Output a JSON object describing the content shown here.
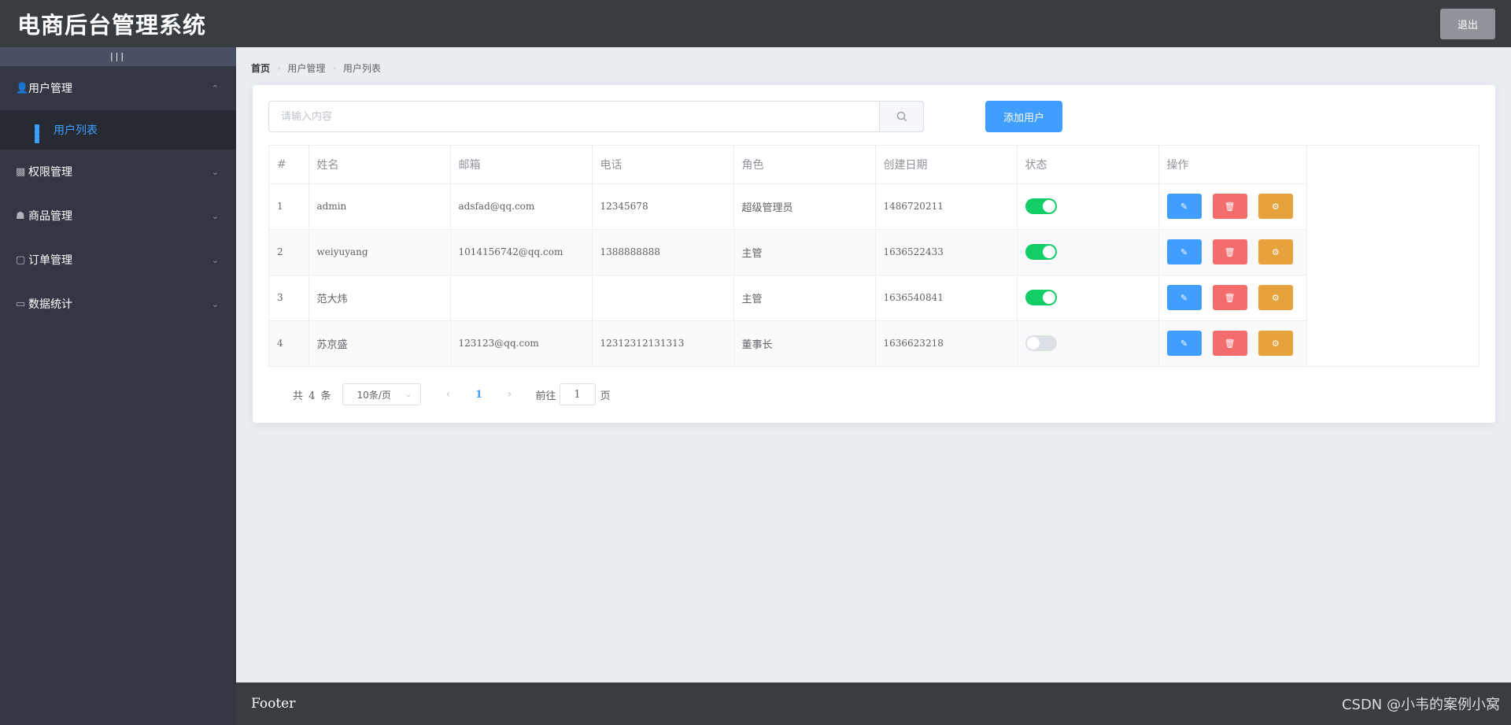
{
  "header": {
    "title": "电商后台管理系统",
    "logout_label": "退出"
  },
  "sidebar": {
    "toggle_label": "|||",
    "menus": [
      {
        "label": "用户管理",
        "icon": "user-icon",
        "expanded": true
      },
      {
        "label": "权限管理",
        "icon": "box-icon",
        "expanded": false
      },
      {
        "label": "商品管理",
        "icon": "shop-icon",
        "expanded": false
      },
      {
        "label": "订单管理",
        "icon": "order-icon",
        "expanded": false
      },
      {
        "label": "数据统计",
        "icon": "monitor-icon",
        "expanded": false
      }
    ],
    "submenu_active": {
      "label": "用户列表",
      "icon": "menu-grid-icon"
    },
    "active_color": "#409eff"
  },
  "breadcrumb": {
    "items": [
      "首页",
      "用户管理",
      "用户列表"
    ]
  },
  "search": {
    "placeholder": "请输入内容"
  },
  "add_user_label": "添加用户",
  "table": {
    "columns": [
      "#",
      "姓名",
      "邮箱",
      "电话",
      "角色",
      "创建日期",
      "状态",
      "操作"
    ],
    "rows": [
      {
        "index": "1",
        "name": "admin",
        "email": "adsfad@qq.com",
        "phone": "12345678",
        "role": "超级管理员",
        "created": "1486720211",
        "state": true
      },
      {
        "index": "2",
        "name": "weiyuyang",
        "email": "1014156742@qq.com",
        "phone": "1388888888",
        "role": "主管",
        "created": "1636522433",
        "state": true
      },
      {
        "index": "3",
        "name": "范大炜",
        "email": "",
        "phone": "",
        "role": "主管",
        "created": "1636540841",
        "state": true
      },
      {
        "index": "4",
        "name": "苏京盛",
        "email": "123123@qq.com",
        "phone": "12312312131313",
        "role": "董事长",
        "created": "1636623218",
        "state": false
      }
    ]
  },
  "pagination": {
    "total_text": "共 4 条",
    "page_size": "10条/页",
    "current_page": "1",
    "goto_label": "前往",
    "goto_value": "1",
    "page_label": "页"
  },
  "footer": {
    "text": "Footer",
    "watermark": "CSDN @小韦的案例小窝"
  },
  "colors": {
    "header_bg": "#373d41",
    "sidebar_bg": "#333744",
    "primary": "#409eff",
    "danger": "#f56c6c",
    "warning": "#e6a23c",
    "switch_on": "#13ce66"
  }
}
